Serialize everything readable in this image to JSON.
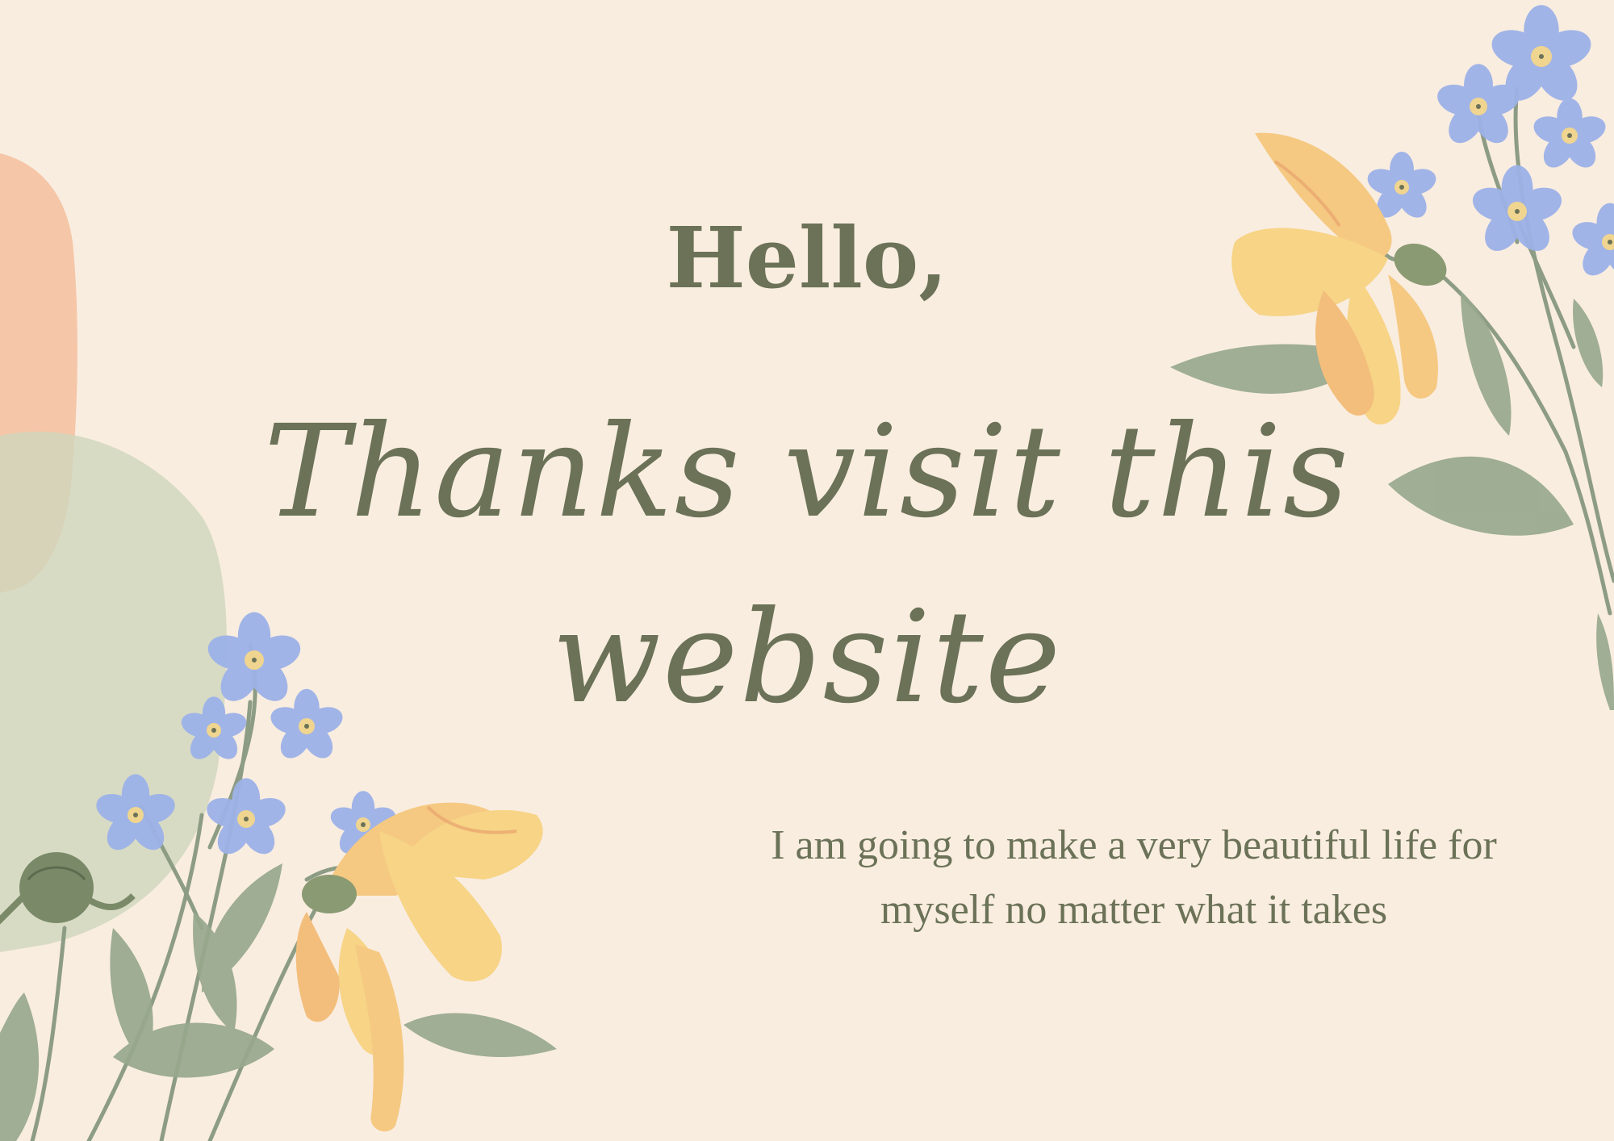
{
  "card": {
    "greeting": "Hello,",
    "headline": "Thanks visit this website",
    "tagline": "I am going to make a very beautiful life for myself no matter what it takes"
  },
  "palette": {
    "background": "#f9ede0",
    "text": "#6b7257",
    "blue_flower": "#9db2e8",
    "yellow_flower": "#f7d486",
    "leaf": "#97a88d",
    "peach_wash": "#f3b894",
    "sage_wash": "#cfd6bd"
  },
  "decorations": [
    "watercolor-peach-brushstroke",
    "watercolor-sage-brushstroke",
    "forget-me-not-flowers",
    "yellow-lily-flowers",
    "green-leaves",
    "flower-bud"
  ]
}
